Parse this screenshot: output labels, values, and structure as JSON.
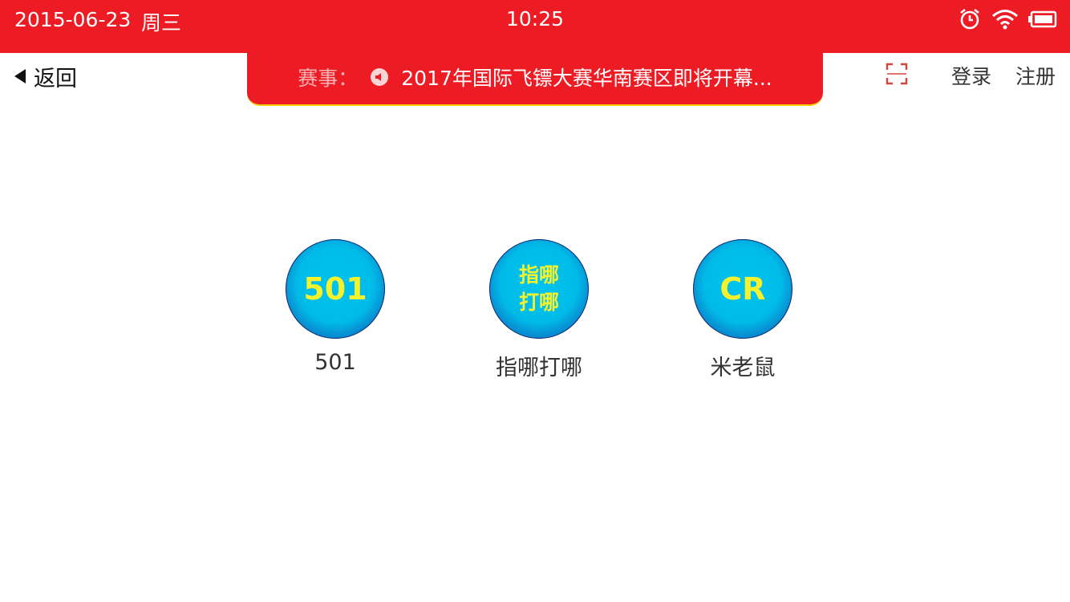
{
  "status_bar": {
    "date": "2015-06-23",
    "weekday": "周三",
    "time": "10:25",
    "icons": [
      "alarm-icon",
      "wifi-icon",
      "battery-icon"
    ]
  },
  "nav": {
    "back_label": "返回",
    "login_label": "登录",
    "register_label": "注册",
    "scan_icon": "scan-icon"
  },
  "ticker": {
    "label": "赛事：",
    "text": "2017年国际飞镖大赛华南赛区即将开幕..."
  },
  "games": [
    {
      "icon_text": "501",
      "label": "501"
    },
    {
      "icon_line1": "指哪",
      "icon_line2": "打哪",
      "label": "指哪打哪"
    },
    {
      "icon_text": "CR",
      "label": "米老鼠"
    }
  ],
  "colors": {
    "brand_red": "#ed1c24",
    "circle_blue": "#00bbe8",
    "circle_text_yellow": "#f3f22d"
  }
}
